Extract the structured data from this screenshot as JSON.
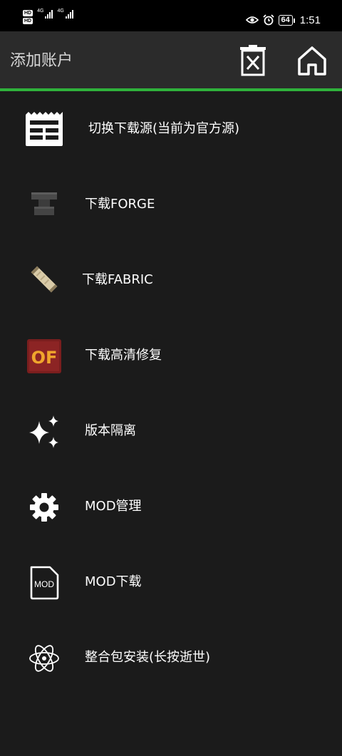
{
  "status_bar": {
    "hd_label": "HD",
    "network_1": "4G",
    "network_2": "4G",
    "battery": "64",
    "time": "1:51",
    "icons": [
      "hd-icon",
      "signal-icon",
      "eye-icon",
      "alarm-icon",
      "battery-icon"
    ]
  },
  "toolbar": {
    "title": "添加账户",
    "delete_icon": "delete-box-icon",
    "home_icon": "home-icon",
    "accent_color": "#2fb33b"
  },
  "menu": {
    "items": [
      {
        "label": "切换下载源(当前为官方源)",
        "icon": "download-source-icon"
      },
      {
        "label": "下载FORGE",
        "icon": "anvil-icon"
      },
      {
        "label": "下载FABRIC",
        "icon": "fabric-scroll-icon"
      },
      {
        "label": "下载高清修复",
        "icon": "optifine-icon",
        "icon_text": "OF"
      },
      {
        "label": "版本隔离",
        "icon": "sparkle-icon"
      },
      {
        "label": "MOD管理",
        "icon": "gear-icon"
      },
      {
        "label": "MOD下载",
        "icon": "mod-file-icon",
        "icon_text": "MOD"
      },
      {
        "label": "整合包安装(长按逝世)",
        "icon": "atom-icon"
      }
    ]
  }
}
